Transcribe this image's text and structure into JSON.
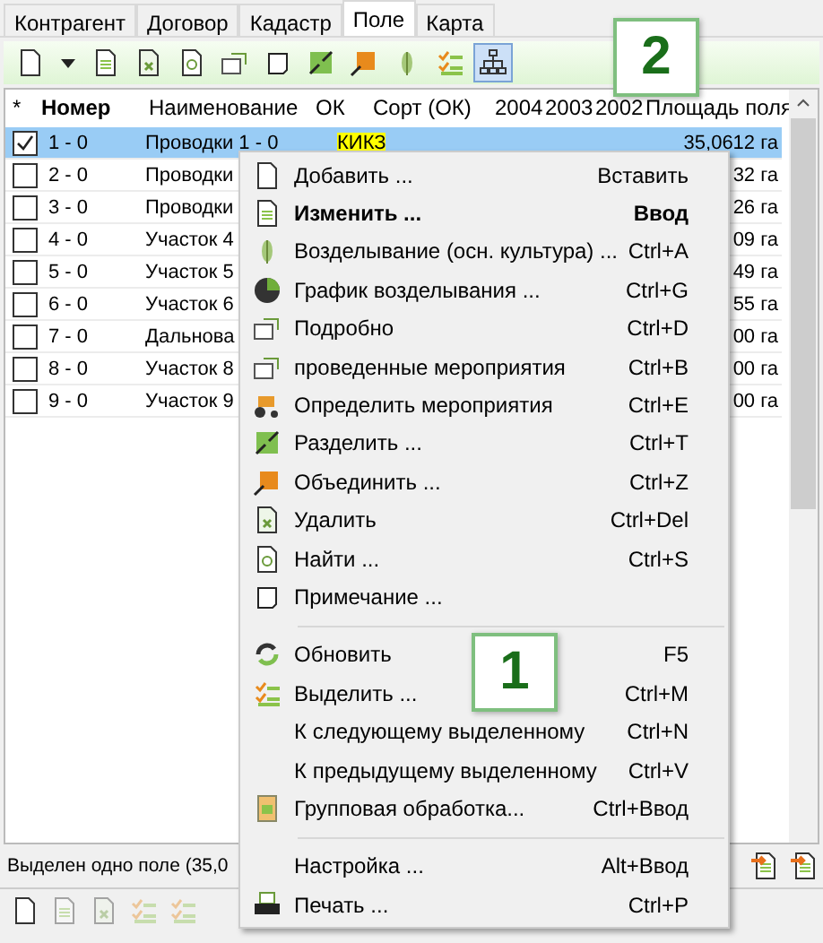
{
  "tabs": [
    {
      "label": "Контрагент",
      "selected": false
    },
    {
      "label": "Договор",
      "selected": false
    },
    {
      "label": "Кадастр",
      "selected": false
    },
    {
      "label": "Поле",
      "selected": true
    },
    {
      "label": "Карта",
      "selected": false
    }
  ],
  "toolbar": [
    {
      "pressed": false
    },
    {
      "pressed": false
    },
    {
      "pressed": false
    },
    {
      "pressed": false
    },
    {
      "pressed": false
    },
    {
      "pressed": false
    },
    {
      "pressed": false
    },
    {
      "pressed": false
    },
    {
      "pressed": false
    },
    {
      "pressed": false
    },
    {
      "pressed": true
    }
  ],
  "columns": [
    {
      "label": "*",
      "sorted": false
    },
    {
      "label": "Номер",
      "sorted": true
    },
    {
      "label": "Наименование",
      "sorted": false
    },
    {
      "label": "ОК",
      "sorted": false
    },
    {
      "label": "Сорт (ОК)",
      "sorted": false
    },
    {
      "label": "2004",
      "sorted": false
    },
    {
      "label": "2003",
      "sorted": false
    },
    {
      "label": "2002",
      "sorted": false
    },
    {
      "label": "Площадь поля",
      "sorted": false
    }
  ],
  "rows": [
    {
      "number": "1 - 0",
      "name": "Проводки 1 - 0",
      "ok": "КИКЗ",
      "area": "35,0612 га",
      "checked": true,
      "selected": true
    },
    {
      "number": "2 - 0",
      "name": "Проводки",
      "area": "32 га",
      "checked": false,
      "selected": false
    },
    {
      "number": "3 - 0",
      "name": "Проводки",
      "area": "26 га",
      "checked": false,
      "selected": false
    },
    {
      "number": "4 - 0",
      "name": "Участок 4",
      "area": "09 га",
      "checked": false,
      "selected": false
    },
    {
      "number": "5 - 0",
      "name": "Участок 5",
      "area": "49 га",
      "checked": false,
      "selected": false
    },
    {
      "number": "6 - 0",
      "name": "Участок 6",
      "area": "55 га",
      "checked": false,
      "selected": false
    },
    {
      "number": "7 - 0",
      "name": "Дальнова",
      "area": "00 га",
      "checked": false,
      "selected": false
    },
    {
      "number": "8 - 0",
      "name": "Участок 8",
      "area": "00 га",
      "checked": false,
      "selected": false
    },
    {
      "number": "9 - 0",
      "name": "Участок 9",
      "area": "00 га",
      "checked": false,
      "selected": false
    }
  ],
  "status": "Выделен одно поле (35,0",
  "menu": [
    {
      "label": "Добавить ...",
      "shortcut": "Вставить",
      "default": false
    },
    {
      "label": "Изменить ...",
      "shortcut": "Ввод",
      "default": true
    },
    {
      "label": "Возделывание (осн. культура) ...",
      "shortcut": "Ctrl+A",
      "default": false
    },
    {
      "label": "График возделывания ...",
      "shortcut": "Ctrl+G",
      "default": false
    },
    {
      "label": "Подробно",
      "shortcut": "Ctrl+D",
      "default": false
    },
    {
      "label": "проведенные мероприятия",
      "shortcut": "Ctrl+B",
      "default": false
    },
    {
      "label": "Определить мероприятия",
      "shortcut": "Ctrl+E",
      "default": false
    },
    {
      "label": "Разделить ...",
      "shortcut": "Ctrl+T",
      "default": false
    },
    {
      "label": "Объединить ...",
      "shortcut": "Ctrl+Z",
      "default": false
    },
    {
      "label": "Удалить",
      "shortcut": "Ctrl+Del",
      "default": false
    },
    {
      "label": "Найти ...",
      "shortcut": "Ctrl+S",
      "default": false
    },
    {
      "label": "Примечание ...",
      "default": false,
      "separator_after": true
    },
    {
      "label": "Обновить",
      "shortcut": "F5",
      "default": false
    },
    {
      "label": "Выделить ...",
      "shortcut": "Ctrl+M",
      "default": false
    },
    {
      "label": "К следующему выделенному",
      "shortcut": "Ctrl+N",
      "default": false
    },
    {
      "label": "К предыдущему выделенному",
      "shortcut": "Ctrl+V",
      "default": false
    },
    {
      "label": "Групповая обработка...",
      "shortcut": "Ctrl+Ввод",
      "default": false,
      "separator_after": true
    },
    {
      "label": "Настройка ...",
      "shortcut": "Alt+Ввод",
      "default": false
    },
    {
      "label": "Печать ...",
      "shortcut": "Ctrl+P",
      "default": false
    }
  ],
  "callouts": [
    {
      "label": "1"
    },
    {
      "label": "2"
    }
  ]
}
